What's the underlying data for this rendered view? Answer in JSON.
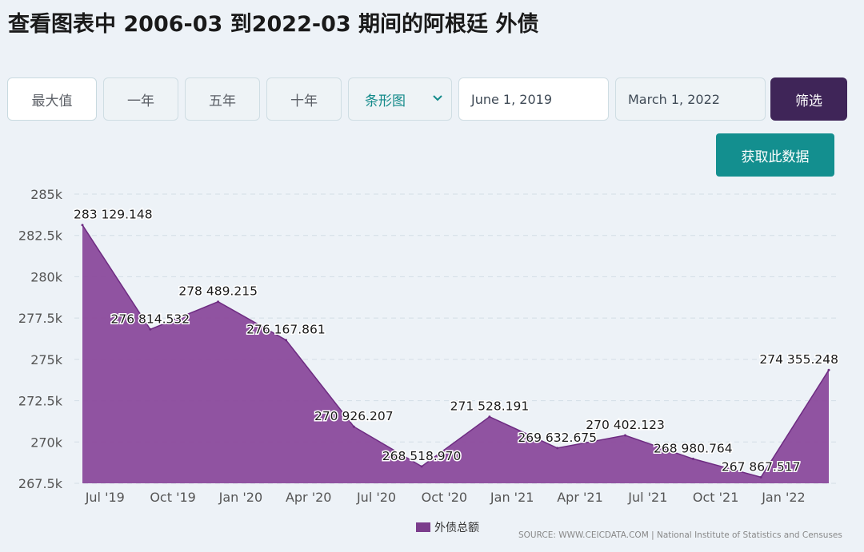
{
  "page": {
    "title": "查看图表中 2006-03 到2022-03 期间的阿根廷 外债"
  },
  "controls": {
    "range_buttons": [
      "最大值",
      "一年",
      "五年",
      "十年"
    ],
    "chart_type": "条形图",
    "start_date": "June 1, 2019",
    "end_date": "March 1, 2022",
    "filter_label": "筛选",
    "get_data_label": "获取此数据"
  },
  "source": "SOURCE: WWW.CEICDATA.COM | National Institute of Statistics and Censuses",
  "colors": {
    "area_fill": "#8b4a9c",
    "area_line": "#6e2c82",
    "legend": "#7b3d8c",
    "filter_button": "#3f2558",
    "data_button": "#138f8f"
  },
  "chart_data": {
    "type": "area",
    "x": [
      "2019-06",
      "2019-09",
      "2019-12",
      "2020-03",
      "2020-06",
      "2020-09",
      "2020-12",
      "2021-03",
      "2021-06",
      "2021-09",
      "2021-12",
      "2022-03"
    ],
    "series": [
      {
        "name": "外债总额",
        "values": [
          283129.148,
          276814.532,
          278489.215,
          276167.861,
          270926.207,
          268518.97,
          271528.191,
          269632.675,
          270402.123,
          268980.764,
          267867.517,
          274355.248
        ],
        "labels": [
          "283 129.148",
          "276 814.532",
          "278 489.215",
          "276 167.861",
          "270 926.207",
          "268 518.970",
          "271 528.191",
          "269 632.675",
          "270 402.123",
          "268 980.764",
          "267 867.517",
          "274 355.248"
        ]
      }
    ],
    "y_ticks": [
      267500,
      270000,
      272500,
      275000,
      277500,
      280000,
      282500,
      285000
    ],
    "y_tick_labels": [
      "267.5k",
      "270k",
      "272.5k",
      "275k",
      "277.5k",
      "280k",
      "282.5k",
      "285k"
    ],
    "x_tick_labels": [
      "Jul '19",
      "Oct '19",
      "Jan '20",
      "Apr '20",
      "Jul '20",
      "Oct '20",
      "Jan '21",
      "Apr '21",
      "Jul '21",
      "Oct '21",
      "Jan '22"
    ],
    "ylim": [
      267500,
      285000
    ],
    "grid": true,
    "legend_position": "bottom"
  }
}
